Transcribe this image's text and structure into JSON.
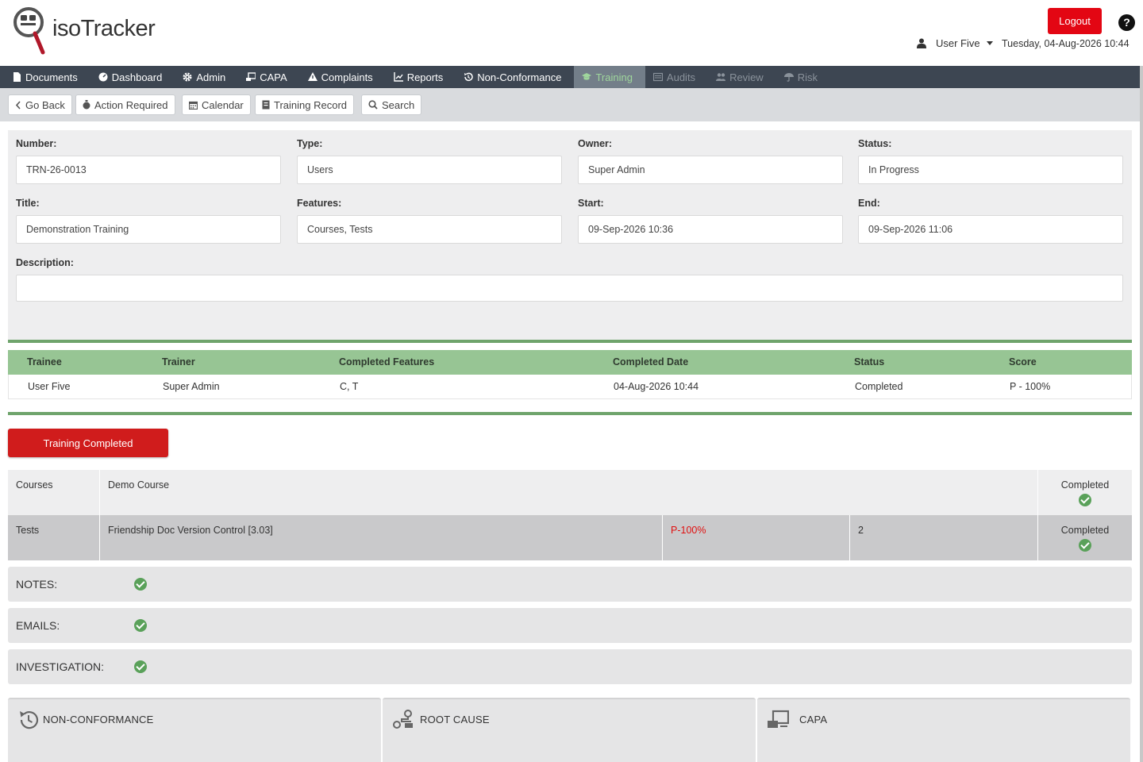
{
  "app": {
    "logo_text": "isoTracker",
    "logout_label": "Logout",
    "help_label": "?",
    "user_name": "User Five",
    "datetime": "Tuesday, 04-Aug-2026 10:44"
  },
  "nav": {
    "items": [
      {
        "label": "Documents",
        "icon": "document-icon"
      },
      {
        "label": "Dashboard",
        "icon": "dashboard-icon"
      },
      {
        "label": "Admin",
        "icon": "gear-icon"
      },
      {
        "label": "CAPA",
        "icon": "capa-icon"
      },
      {
        "label": "Complaints",
        "icon": "warning-icon"
      },
      {
        "label": "Reports",
        "icon": "chart-icon"
      },
      {
        "label": "Non-Conformance",
        "icon": "history-icon"
      },
      {
        "label": "Training",
        "icon": "graduation-icon",
        "state": "active"
      },
      {
        "label": "Audits",
        "icon": "audit-icon",
        "state": "disabled"
      },
      {
        "label": "Review",
        "icon": "people-icon",
        "state": "disabled"
      },
      {
        "label": "Risk",
        "icon": "umbrella-icon",
        "state": "disabled"
      }
    ]
  },
  "toolbar": {
    "go_back": "Go Back",
    "action_required": "Action Required",
    "calendar": "Calendar",
    "training_record": "Training Record",
    "search": "Search"
  },
  "form": {
    "number_label": "Number:",
    "number": "TRN-26-0013",
    "type_label": "Type:",
    "type": "Users",
    "owner_label": "Owner:",
    "owner": "Super Admin",
    "status_label": "Status:",
    "status": "In Progress",
    "title_label": "Title:",
    "title": "Demonstration Training",
    "features_label": "Features:",
    "features": "Courses, Tests",
    "start_label": "Start:",
    "start": "09-Sep-2026 10:36",
    "end_label": "End:",
    "end": "09-Sep-2026 11:06",
    "description_label": "Description:",
    "description": ""
  },
  "trainee_table": {
    "headers": {
      "trainee": "Trainee",
      "trainer": "Trainer",
      "completed_features": "Completed Features",
      "completed_date": "Completed Date",
      "status": "Status",
      "score": "Score"
    },
    "row": {
      "trainee": "User Five",
      "trainer": "Super Admin",
      "completed_features": "C, T",
      "completed_date": "04-Aug-2026 10:44",
      "status": "Completed",
      "score": "P - 100%"
    }
  },
  "training_completed_label": "Training Completed",
  "courses_row": {
    "label": "Courses",
    "name": "Demo Course",
    "status": "Completed"
  },
  "tests_row": {
    "label": "Tests",
    "name": "Friendship Doc Version Control [3.03]",
    "score": "P-100%",
    "count": "2",
    "status": "Completed"
  },
  "sections": {
    "notes": "NOTES:",
    "emails": "EMAILS:",
    "investigation": "INVESTIGATION:"
  },
  "cards": {
    "non_conformance": "NON-CONFORMANCE",
    "root_cause": "ROOT CAUSE",
    "capa": "CAPA"
  },
  "colors": {
    "nav_bg": "#3d4652",
    "active_tab_bg": "#737e89",
    "active_tab_text": "#9fd69c",
    "table_header": "#97c594",
    "accent_green": "#6fa46c",
    "logout_red": "#e30613",
    "button_red": "#d01c1c",
    "score_red": "#e01010"
  }
}
